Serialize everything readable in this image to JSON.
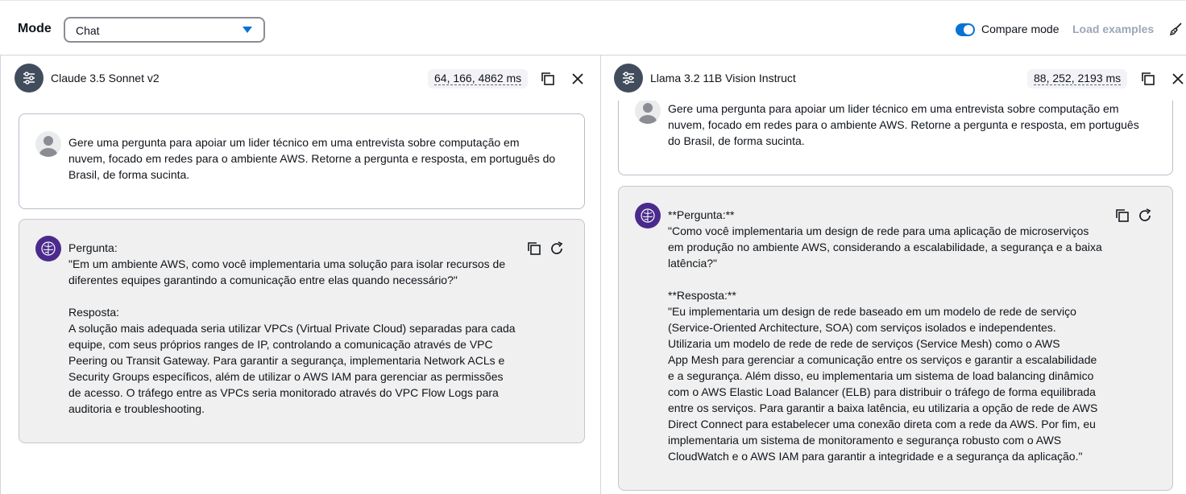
{
  "header": {
    "mode_label": "Mode",
    "mode_value": "Chat",
    "compare_label": "Compare mode",
    "compare_enabled": true,
    "load_examples": "Load examples"
  },
  "colors": {
    "accent": "#0972d3",
    "bot_avatar": "#4a2a8c",
    "model_avatar": "#414d5c"
  },
  "left": {
    "model_name": "Claude 3.5 Sonnet v2",
    "metrics": "64, 166, 4862 ms",
    "user_message": "Gere uma pergunta para apoiar um lider técnico em uma entrevista sobre computação em\nnuvem, focado em redes para o ambiente AWS. Retorne a pergunta e resposta, em português do\nBrasil, de forma sucinta.",
    "bot_message": "Pergunta:\n\"Em um ambiente AWS, como você implementaria uma solução para isolar recursos de\ndiferentes equipes garantindo a comunicação entre elas quando necessário?\"\n\nResposta:\nA solução mais adequada seria utilizar VPCs (Virtual Private Cloud) separadas para cada\nequipe, com seus próprios ranges de IP, controlando a comunicação através de VPC\nPeering ou Transit Gateway. Para garantir a segurança, implementaria Network ACLs e\nSecurity Groups específicos, além de utilizar o AWS IAM para gerenciar as permissões\nde acesso. O tráfego entre as VPCs seria monitorado através do VPC Flow Logs para\nauditoria e troubleshooting."
  },
  "right": {
    "model_name": "Llama 3.2 11B Vision Instruct",
    "metrics": "88, 252, 2193 ms",
    "user_message": "Gere uma pergunta para apoiar um lider técnico em uma entrevista sobre computação em\nnuvem, focado em redes para o ambiente AWS. Retorne a pergunta e resposta, em português\ndo Brasil, de forma sucinta.",
    "bot_message": "**Pergunta:**\n\"Como você implementaria um design de rede para uma aplicação de microserviços\nem produção no ambiente AWS, considerando a escalabilidade, a segurança e a baixa\nlatência?\"\n\n**Resposta:**\n\"Eu implementaria um design de rede baseado em um modelo de rede de serviço\n(Service-Oriented Architecture, SOA) com serviços isolados e independentes.\nUtilizaria um modelo de rede de rede de serviços (Service Mesh) como o AWS\nApp Mesh para gerenciar a comunicação entre os serviços e garantir a escalabilidade\ne a segurança. Além disso, eu implementaria um sistema de load balancing dinâmico\ncom o AWS Elastic Load Balancer (ELB) para distribuir o tráfego de forma equilibrada\nentre os serviços. Para garantir a baixa latência, eu utilizaria a opção de rede de AWS\nDirect Connect para estabelecer uma conexão direta com a rede da AWS. Por fim, eu\nimplementaria um sistema de monitoramento e segurança robusto com o AWS\nCloudWatch e o AWS IAM para garantir a integridade e a segurança da aplicação.\""
  }
}
